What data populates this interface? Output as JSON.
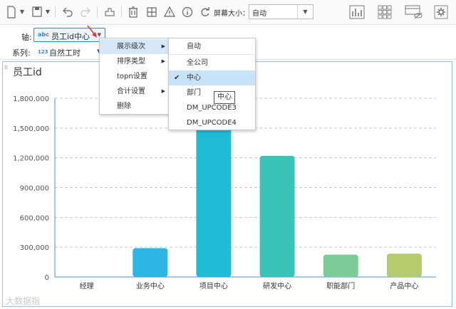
{
  "toolbar": {
    "screen_size_label": "屏幕大小：",
    "screen_size_value": "自动"
  },
  "fields": {
    "axis_label": "轴:",
    "axis_type": "abc",
    "axis_field": "员工id中心",
    "series_label": "系列:",
    "series_type": "123",
    "series_field": "自然工时"
  },
  "context_menu": {
    "items": [
      {
        "label": "展示级次",
        "has_submenu": true
      },
      {
        "label": "排序类型",
        "has_submenu": true
      },
      {
        "label": "topn设置",
        "has_submenu": false
      },
      {
        "label": "合计设置",
        "has_submenu": true
      },
      {
        "label": "删除",
        "has_submenu": false
      }
    ]
  },
  "submenu": {
    "items": [
      {
        "label": "自动"
      },
      {
        "label": "全公司"
      },
      {
        "label": "中心",
        "checked": true
      },
      {
        "label": "部门"
      },
      {
        "label": "DM_UPCODE3"
      },
      {
        "label": "DM_UPCODE4"
      }
    ],
    "tooltip": "中心"
  },
  "chart_data": {
    "type": "bar",
    "title": "员工id",
    "categories": [
      "经理",
      "业务中心",
      "项目中心",
      "研发中心",
      "职能部门",
      "产品中心"
    ],
    "values": [
      0,
      290000,
      1570000,
      1220000,
      225000,
      235000
    ],
    "colors": [
      "#4aa3e4",
      "#2fb4e6",
      "#20bbd6",
      "#38c4b8",
      "#7dcb96",
      "#b4cc6c"
    ],
    "yticks": [
      "0",
      "300,000",
      "600,000",
      "900,000",
      "1,200,000",
      "1,500,000",
      "1,800,000"
    ],
    "ylim": [
      0,
      1800000
    ],
    "grid": true
  },
  "watermark": "大数据指"
}
